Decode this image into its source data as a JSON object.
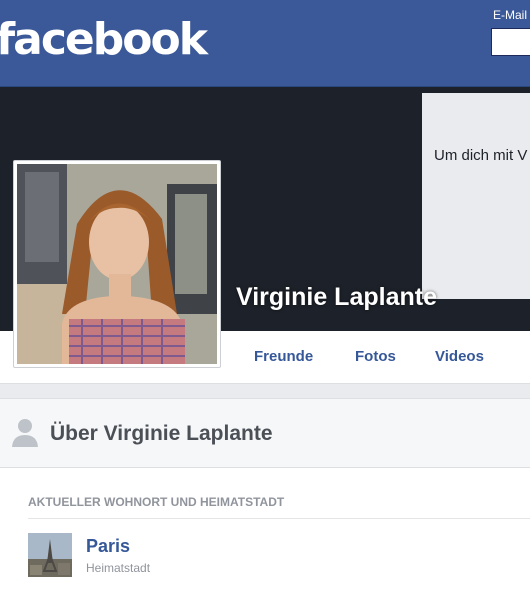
{
  "header": {
    "logo_text": "facebook",
    "email_label": "E-Mail",
    "email_value": "",
    "brand_color": "#3b5998"
  },
  "cover": {
    "promo_text": "Um dich mit V"
  },
  "profile": {
    "name": "Virginie Laplante"
  },
  "nav": {
    "tabs": [
      {
        "label": "Freunde"
      },
      {
        "label": "Fotos"
      },
      {
        "label": "Videos"
      }
    ]
  },
  "about": {
    "title": "Über Virginie Laplante",
    "subheading": "AKTUELLER WOHNORT UND HEIMATSTADT",
    "places": [
      {
        "name": "Paris",
        "type": "Heimatstadt"
      }
    ]
  },
  "icons": {
    "about": "person-icon",
    "place": "eiffel-tower-thumbnail"
  }
}
